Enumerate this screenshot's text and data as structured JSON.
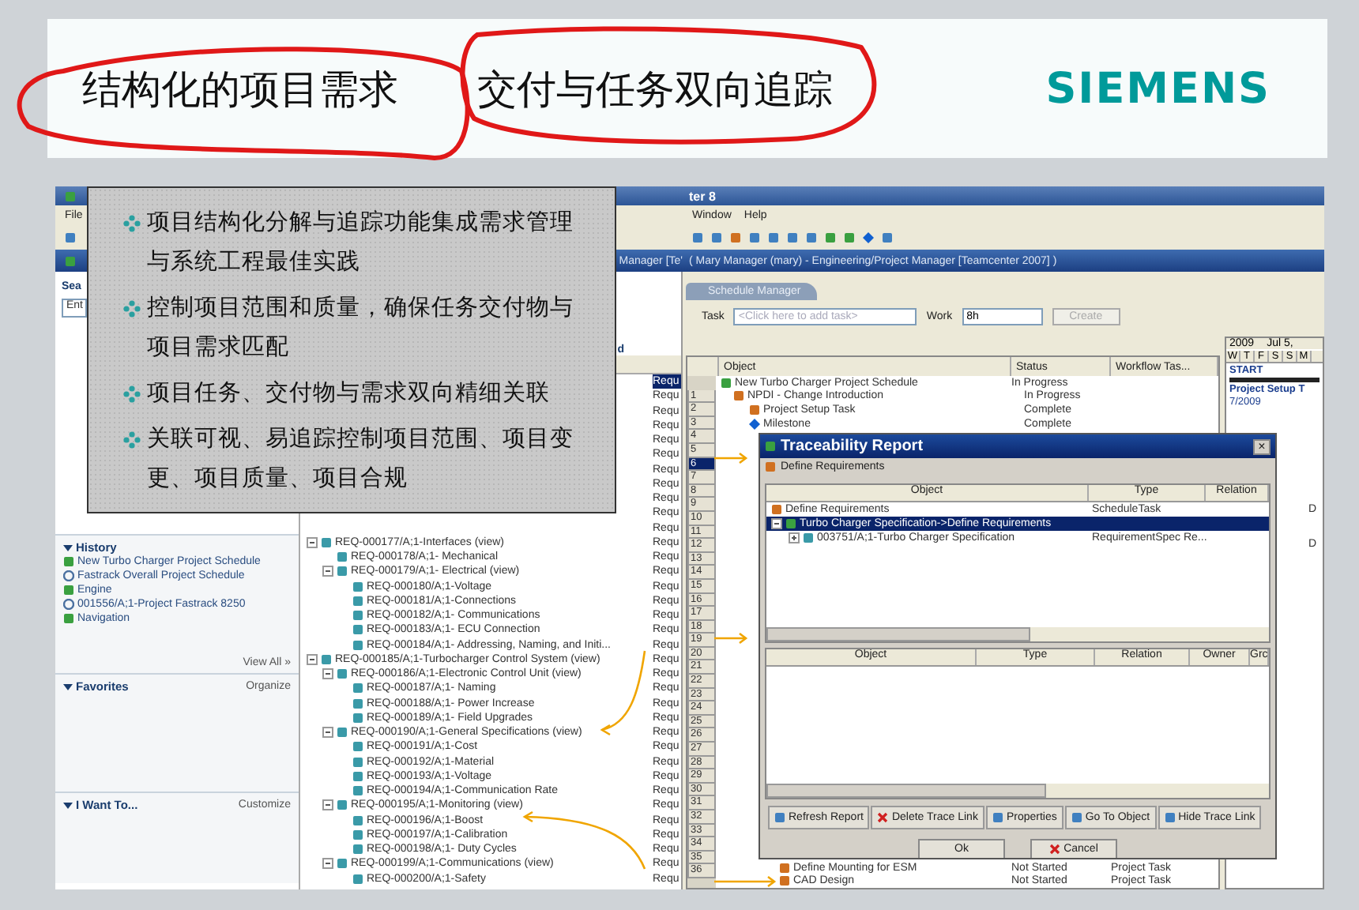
{
  "slide": {
    "title_part_1": "结构化的项目需求",
    "title_part_2": "交付与任务双向追踪",
    "logo": "SIEMENS"
  },
  "callout": {
    "bullets": [
      "项目结构化分解与追踪功能集成需求管理与系统工程最佳实践",
      "控制项目范围和质量，确保任务交付物与项目需求匹配",
      "项目任务、交付物与需求双向精细关联",
      "关联可视、易追踪控制项目范围、项目变更、项目质量、项目合规"
    ]
  },
  "app": {
    "title": "ter 8",
    "menu_left": [
      "File"
    ],
    "menu_right": [
      "Window",
      "Help"
    ],
    "header_left": "Manager  [Te'",
    "header_right": "( Mary Manager (mary) - Engineering/Project Manager  [Teamcenter 2007] )"
  },
  "left_panel": {
    "search_label": "Sea",
    "search_value": "Ent",
    "history": {
      "title": "History",
      "expanded": true,
      "items": [
        "New Turbo Charger Project Schedule",
        "Fastrack Overall Project Schedule",
        "Engine",
        "001556/A;1-Project Fastrack 8250",
        "Navigation"
      ],
      "view_all": "View All »"
    },
    "favorites": {
      "title": "Favorites",
      "expanded": true,
      "action": "Organize"
    },
    "i_want_to": {
      "title": "I Want To...",
      "expanded": true,
      "action": "Customize"
    }
  },
  "tree": {
    "header": "d",
    "hidden_rows": [
      {
        "type": "Requ",
        "selected": true
      },
      {
        "type": "Requ",
        "selected": false
      },
      {
        "type": "Requ",
        "selected": false
      },
      {
        "type": "Requ",
        "selected": false
      },
      {
        "type": "Requ",
        "selected": false
      },
      {
        "type": "Requ",
        "selected": false
      },
      {
        "type": "Requ",
        "selected": false
      },
      {
        "type": "Requ",
        "selected": false
      },
      {
        "type": "Requ",
        "selected": false
      },
      {
        "type": "Requ",
        "selected": false
      },
      {
        "type": "Requ",
        "selected": false
      }
    ],
    "items": [
      {
        "label": "REQ-000177/A;1-Interfaces (view)",
        "type": "Requ",
        "expanded": true,
        "children": [
          {
            "label": "REQ-000178/A;1- Mechanical",
            "type": "Requ"
          },
          {
            "label": "REQ-000179/A;1- Electrical (view)",
            "type": "Requ",
            "expanded": true,
            "children": [
              {
                "label": "REQ-000180/A;1-Voltage",
                "type": "Requ"
              },
              {
                "label": "REQ-000181/A;1-Connections",
                "type": "Requ"
              },
              {
                "label": "REQ-000182/A;1- Communications",
                "type": "Requ"
              },
              {
                "label": "REQ-000183/A;1- ECU Connection",
                "type": "Requ"
              },
              {
                "label": "REQ-000184/A;1- Addressing, Naming, and Initi...",
                "type": "Requ"
              }
            ]
          }
        ]
      },
      {
        "label": "REQ-000185/A;1-Turbocharger Control System (view)",
        "type": "Requ",
        "expanded": true,
        "children": [
          {
            "label": "REQ-000186/A;1-Electronic Control Unit (view)",
            "type": "Requ",
            "expanded": true,
            "children": [
              {
                "label": "REQ-000187/A;1- Naming",
                "type": "Requ"
              },
              {
                "label": "REQ-000188/A;1- Power Increase",
                "type": "Requ"
              },
              {
                "label": "REQ-000189/A;1- Field Upgrades",
                "type": "Requ"
              }
            ]
          },
          {
            "label": "REQ-000190/A;1-General Specifications (view)",
            "type": "Requ",
            "expanded": true,
            "children": [
              {
                "label": "REQ-000191/A;1-Cost",
                "type": "Requ"
              },
              {
                "label": "REQ-000192/A;1-Material",
                "type": "Requ"
              },
              {
                "label": "REQ-000193/A;1-Voltage",
                "type": "Requ"
              },
              {
                "label": "REQ-000194/A;1-Communication Rate",
                "type": "Requ"
              }
            ]
          },
          {
            "label": "REQ-000195/A;1-Monitoring (view)",
            "type": "Requ",
            "expanded": true,
            "children": [
              {
                "label": "REQ-000196/A;1-Boost",
                "type": "Requ"
              },
              {
                "label": "REQ-000197/A;1-Calibration",
                "type": "Requ"
              },
              {
                "label": "REQ-000198/A;1- Duty Cycles",
                "type": "Requ"
              }
            ]
          },
          {
            "label": "REQ-000199/A;1-Communications (view)",
            "type": "Requ",
            "expanded": true,
            "children": [
              {
                "label": "REQ-000200/A;1-Safety",
                "type": "Requ"
              }
            ]
          }
        ]
      }
    ]
  },
  "schedule_manager": {
    "tab": "Schedule Manager",
    "task_label": "Task",
    "task_placeholder": "<Click here to add task>",
    "work_label": "Work",
    "work_value": "8h",
    "create_button": "Create",
    "columns": [
      "Object",
      "Status",
      "Workflow Tas..."
    ],
    "row_numbers": [
      {
        "label": "1",
        "selected": false
      },
      {
        "label": "2",
        "selected": false
      },
      {
        "label": "3",
        "selected": false
      },
      {
        "label": "4",
        "selected": false
      },
      {
        "label": "5",
        "selected": false
      },
      {
        "label": "6",
        "selected": true
      },
      {
        "label": "7",
        "selected": false
      },
      {
        "label": "8",
        "selected": false
      },
      {
        "label": "9",
        "selected": false
      },
      {
        "label": "10",
        "selected": false
      },
      {
        "label": "11",
        "selected": false
      },
      {
        "label": "12",
        "selected": false
      },
      {
        "label": "13",
        "selected": false
      },
      {
        "label": "14",
        "selected": false
      },
      {
        "label": "15",
        "selected": false
      },
      {
        "label": "16",
        "selected": false
      },
      {
        "label": "17",
        "selected": false
      },
      {
        "label": "18",
        "selected": false
      },
      {
        "label": "19",
        "selected": false
      },
      {
        "label": "20",
        "selected": false
      },
      {
        "label": "21",
        "selected": false
      },
      {
        "label": "22",
        "selected": false
      },
      {
        "label": "23",
        "selected": false
      },
      {
        "label": "24",
        "selected": false
      },
      {
        "label": "25",
        "selected": false
      },
      {
        "label": "26",
        "selected": false
      },
      {
        "label": "27",
        "selected": false
      },
      {
        "label": "28",
        "selected": false
      },
      {
        "label": "29",
        "selected": false
      },
      {
        "label": "30",
        "selected": false
      },
      {
        "label": "31",
        "selected": false
      },
      {
        "label": "32",
        "selected": false
      },
      {
        "label": "33",
        "selected": false
      },
      {
        "label": "34",
        "selected": false
      },
      {
        "label": "35",
        "selected": false
      },
      {
        "label": "36",
        "selected": false
      }
    ],
    "top_rows": [
      {
        "object": "New Turbo Charger Project Schedule",
        "status": "In Progress",
        "kind": "schedule"
      },
      {
        "object": "NPDI - Change Introduction",
        "status": "In Progress",
        "kind": "summary"
      },
      {
        "object": "Project Setup Task",
        "status": "Complete",
        "kind": "task"
      },
      {
        "object": "Milestone",
        "status": "Complete",
        "kind": "milestone"
      }
    ],
    "bottom_rows": [
      {
        "object": "Define Mounting for ESM",
        "status": "Not Started",
        "workflow": "Project Task"
      },
      {
        "object": "CAD Design",
        "status": "Not Started",
        "workflow": "Project Task"
      }
    ],
    "gantt": {
      "year": "2009",
      "month": "Jul 5,",
      "days": [
        "W",
        "T",
        "F",
        "S",
        "S",
        "M"
      ],
      "start": "START",
      "bar_label": "Project Setup T",
      "date": "7/2009",
      "markers": [
        "D",
        "D"
      ]
    }
  },
  "traceability_report": {
    "title": "Traceability Report",
    "close": "×",
    "context": "Define Requirements",
    "upper_columns": [
      "Object",
      "Type",
      "Relation"
    ],
    "upper_rows": [
      {
        "object": "Define Requirements",
        "type": "ScheduleTask",
        "selected": false,
        "kind": "task"
      },
      {
        "object": "Turbo Charger Specification->Define Requirements",
        "selected": true,
        "kind": "link",
        "expanded": true
      },
      {
        "object": "003751/A;1-Turbo Charger Specification",
        "type": "RequirementSpec Re...",
        "selected": false,
        "kind": "requirement",
        "expanded": false
      }
    ],
    "lower_columns": [
      "Object",
      "Type",
      "Relation",
      "Owner",
      "Grc"
    ],
    "actions": [
      "Refresh Report",
      "Delete Trace Link",
      "Properties",
      "Go To Object",
      "Hide Trace Link"
    ],
    "ok": "Ok",
    "cancel": "Cancel"
  }
}
